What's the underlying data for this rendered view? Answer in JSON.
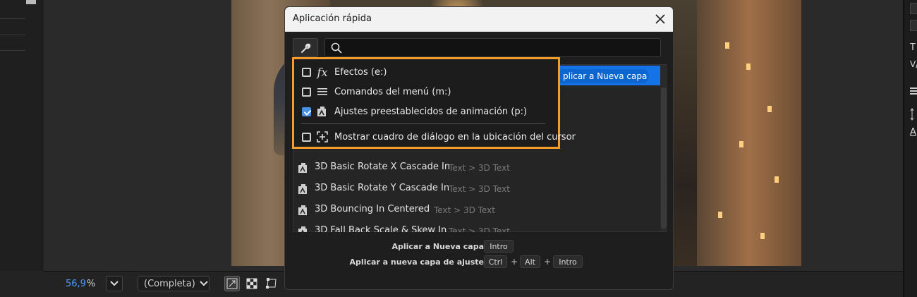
{
  "viewer": {
    "zoom_value": "56,9",
    "zoom_unit": "%",
    "resolution": "(Completa)"
  },
  "right_panel": {
    "texts": [
      "T",
      "V/",
      "A"
    ]
  },
  "dialog": {
    "title": "Aplicación rápida",
    "search": {
      "value": "",
      "placeholder": ""
    },
    "selected_item_action": "plicar a Nueva capa",
    "filters": [
      {
        "label": "Efectos (e:)",
        "checked": false,
        "icon": "fx-icon"
      },
      {
        "label": "Comandos del menú (m:)",
        "checked": false,
        "icon": "menu-lines-icon"
      },
      {
        "label": "Ajustes preestablecidos de animación (p:)",
        "checked": true,
        "icon": "animation-preset-icon"
      },
      {
        "label": "Mostrar cuadro de diálogo en la ubicación del cursor",
        "checked": false,
        "icon": "cursor-location-icon"
      }
    ],
    "results": [
      {
        "name": "3D Basic Rotate X Cascade In",
        "path": "Text > 3D Text"
      },
      {
        "name": "3D Basic Rotate Y Cascade In",
        "path": "Text > 3D Text"
      },
      {
        "name": "3D Bouncing In Centered",
        "path": "Text > 3D Text"
      },
      {
        "name": "3D Fall Back Scale & Skew In",
        "path": "Text > 3D Text"
      }
    ],
    "shortcuts": [
      {
        "label": "Aplicar a Nueva capa",
        "keys": [
          "Intro"
        ]
      },
      {
        "label": "Aplicar a nueva capa de ajuste",
        "keys": [
          "Ctrl",
          "Alt",
          "Intro"
        ],
        "separator": "+"
      }
    ]
  },
  "colors": {
    "accent": "#1473e6",
    "highlight_border": "#f29c2b",
    "zoom_text": "#4c9bff"
  }
}
